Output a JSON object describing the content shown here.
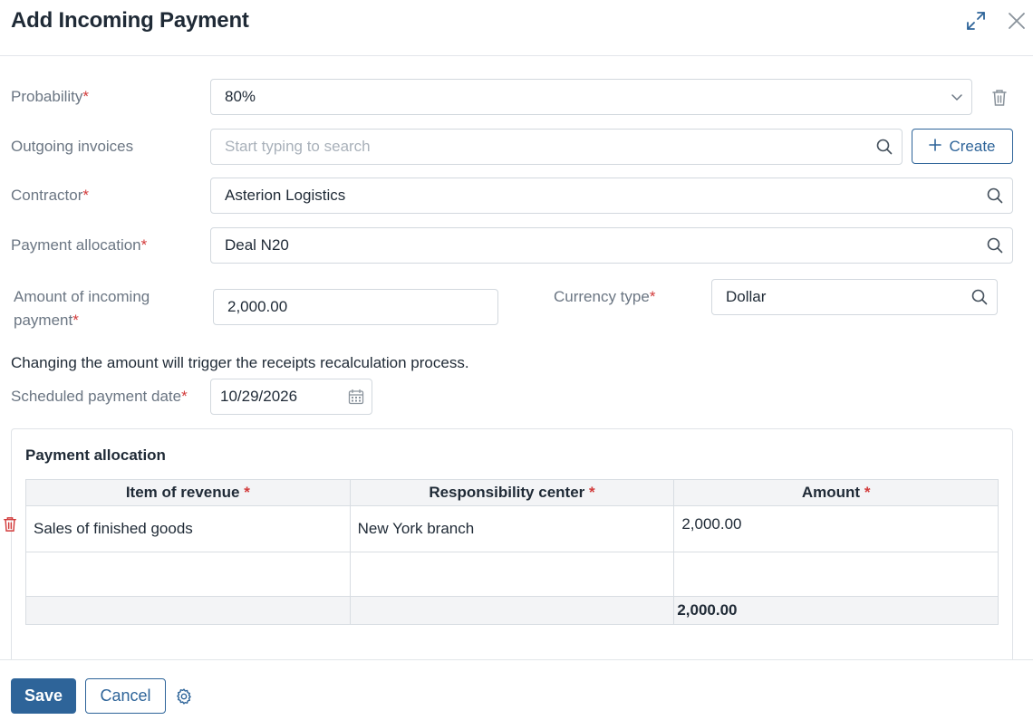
{
  "window": {
    "title": "Add Incoming Payment"
  },
  "form": {
    "probability": {
      "label": "Probability",
      "required_mark": "*",
      "value": "80%"
    },
    "outgoing_invoices": {
      "label": "Outgoing invoices",
      "placeholder": "Start typing to search",
      "create_label": "Create"
    },
    "contractor": {
      "label": "Contractor",
      "required_mark": "*",
      "value": "Asterion Logistics"
    },
    "payment_allocation": {
      "label": "Payment allocation",
      "required_mark": "*",
      "value": "Deal N20"
    },
    "amount": {
      "label_line1": "Amount of incoming",
      "label_line2": "payment",
      "required_mark": "*",
      "value": "2,000.00"
    },
    "currency": {
      "label": "Currency type",
      "required_mark": "*",
      "value": "Dollar"
    },
    "note": "Changing the amount will trigger the receipts recalculation process.",
    "scheduled_date": {
      "label": "Scheduled payment date",
      "required_mark": "*",
      "value": "10/29/2026"
    }
  },
  "allocation_table": {
    "title": "Payment allocation",
    "columns": [
      {
        "label": "Item of revenue",
        "required_mark": "*"
      },
      {
        "label": "Responsibility center",
        "required_mark": "*"
      },
      {
        "label": "Amount",
        "required_mark": "*"
      }
    ],
    "rows": [
      {
        "item": "Sales of finished goods",
        "center": "New York branch",
        "amount": "2,000.00"
      }
    ],
    "total": "2,000.00"
  },
  "footer": {
    "save_label": "Save",
    "cancel_label": "Cancel"
  },
  "colors": {
    "accent": "#2e6499",
    "required": "#d23b3b",
    "delete": "#d23b3b"
  },
  "icons": [
    "expand-icon",
    "close-icon",
    "chevron-down-icon",
    "trash-icon",
    "search-icon",
    "plus-icon",
    "calendar-icon",
    "gear-icon"
  ]
}
